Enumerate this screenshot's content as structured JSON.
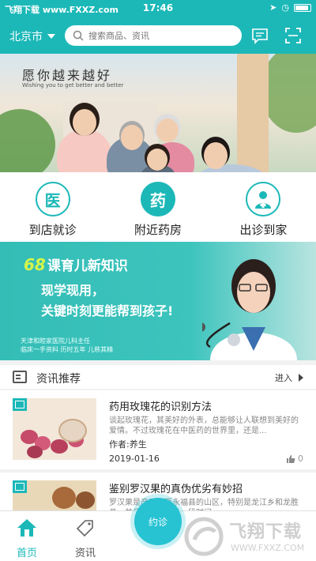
{
  "status_bar": {
    "carrier": "飞翔下载 www.FXXZ.com",
    "time": "17:46"
  },
  "header": {
    "city": "北京市",
    "search_placeholder": "搜索商品、资讯"
  },
  "banner": {
    "slogan": "愿你越来越好",
    "subslogan": "Wishing you to get better and better"
  },
  "quick_actions": [
    {
      "icon_text": "医",
      "label": "到店就诊"
    },
    {
      "icon_text": "药",
      "label": "附近药房"
    },
    {
      "icon_text": "",
      "label": "出诊到家"
    }
  ],
  "promo": {
    "number": "68",
    "headline": "课育儿新知识",
    "line1": "现学现用，",
    "line2": "关键时刻更能帮到孩子!",
    "credit1": "天津和睦家医院儿科主任",
    "credit2": "临床一手资料  历时五年  儿慈其精"
  },
  "news": {
    "section_title": "资讯推荐",
    "more_label": "进入",
    "articles": [
      {
        "title": "药用玫瑰花的识别方法",
        "summary": "谈起玫瑰花，其美好的外表，总能够让人联想到美好的爱情。不过玫瑰花在中医药的世界里，还是...",
        "author": "作者:养生",
        "date": "2019-01-16",
        "likes": "0"
      },
      {
        "title": "鉴别罗汉果的真伪优劣有妙招",
        "summary": "罗汉果是产于广西永福县的山区，特别是龙江乡和龙胜县，并且在过去很长一段时间..."
      }
    ]
  },
  "tabbar": {
    "home": "首页",
    "news": "资讯",
    "center": "约诊",
    "watermark": "飞翔下载",
    "watermark_url": "WWW.FXXZ.COM"
  },
  "colors": {
    "accent": "#1cb8b8",
    "fab": "#27c3d3"
  }
}
